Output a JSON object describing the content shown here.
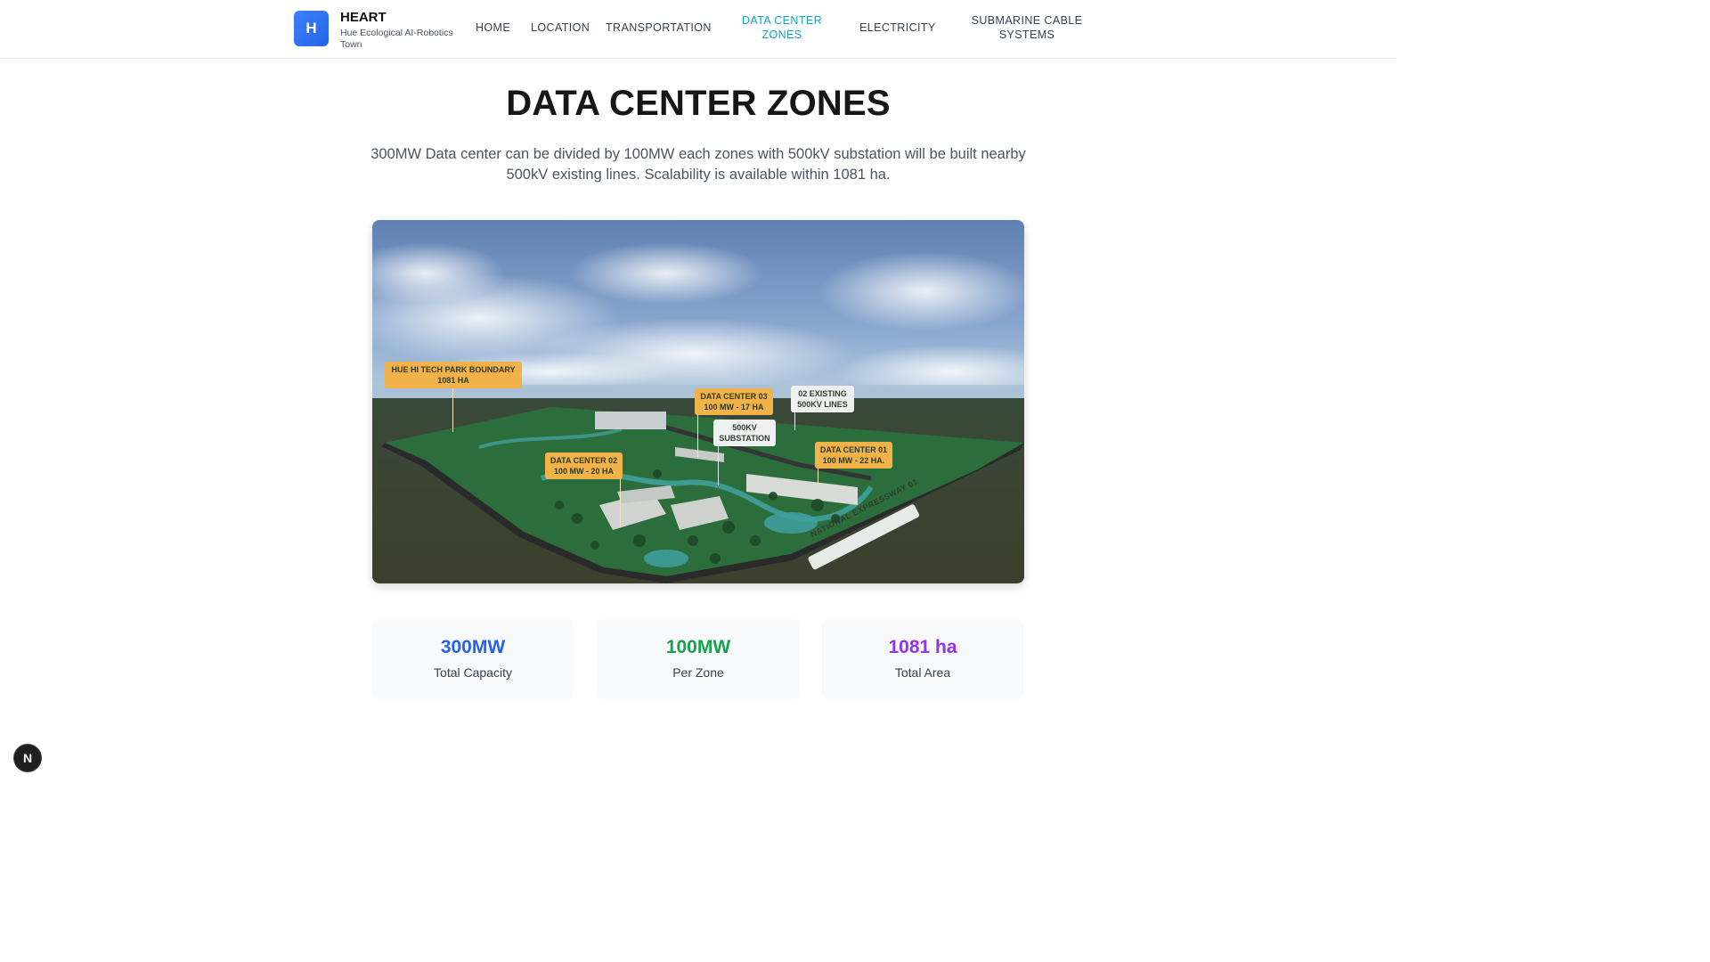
{
  "brand": {
    "logo_letter": "H",
    "name": "HEART",
    "subtitle": "Hue Ecological AI-Robotics Town"
  },
  "nav": {
    "home": "HOME",
    "location": "LOCATION",
    "transportation": "TRANSPORTATION",
    "data_center_zones": "DATA CENTER ZONES",
    "electricity": "ELECTRICITY",
    "submarine": "SUBMARINE CABLE SYSTEMS",
    "active": "DATA CENTER ZONES",
    "active_color": "#0ea5c9"
  },
  "page": {
    "title": "DATA CENTER ZONES",
    "description": "300MW Data center can be divided by 100MW each zones with 500kV substation will be built nearby 500kV existing lines. Scalability is available within 1081 ha."
  },
  "image": {
    "labels": {
      "boundary": "HUE HI TECH PARK BOUNDARY 1081 HA",
      "dc03": "DATA CENTER 03 100 MW - 17 HA",
      "lines": "02 EXISTING 500KV LINES",
      "substation": "500KV SUBSTATION",
      "dc02": "DATA CENTER 02 100 MW - 20 HA",
      "dc01": "DATA CENTER 01 100 MW - 22 HA.",
      "expressway": "NATIONAL EXPRESSWAY 01"
    }
  },
  "stats": [
    {
      "value": "300MW",
      "label": "Total Capacity",
      "color": "#2563eb"
    },
    {
      "value": "100MW",
      "label": "Per Zone",
      "color": "#16a34a"
    },
    {
      "value": "1081 ha",
      "label": "Total Area",
      "color": "#9333ea"
    }
  ],
  "fab": {
    "letter": "N"
  }
}
